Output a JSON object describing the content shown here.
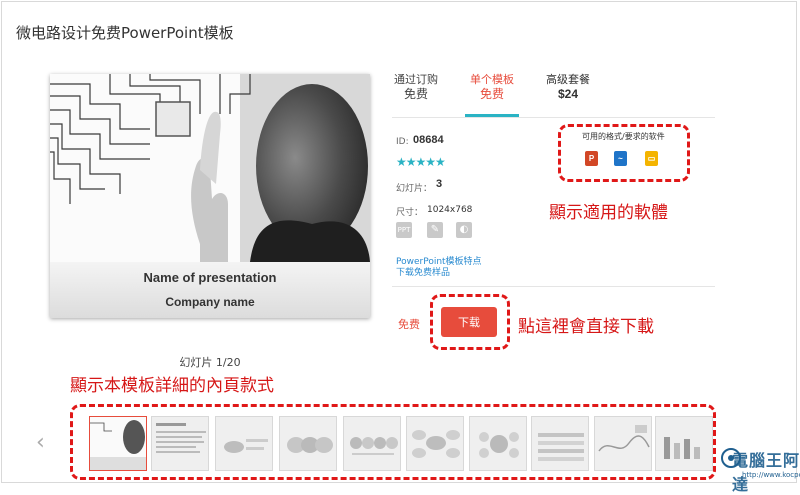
{
  "page_title": "微电路设计免费PowerPoint模板",
  "preview": {
    "presentation_name": "Name of presentation",
    "company_name": "Company name"
  },
  "tabs": [
    {
      "label": "通过订购",
      "price": "免费"
    },
    {
      "label": "单个模板",
      "price": "免费"
    },
    {
      "label": "高级套餐",
      "price": "$24"
    }
  ],
  "details": {
    "id_label": "ID:",
    "id_value": "08684",
    "rating_stars": "★★★★★",
    "rating": 4.5,
    "slides_label": "幻灯片：",
    "slides_value": "3",
    "size_label": "尺寸：",
    "size_value": "1024x768"
  },
  "links": {
    "features": "PowerPoint模板特点",
    "download_sample": "下载免费样品"
  },
  "software": {
    "title": "可用的格式/要求的软件",
    "icons": [
      "powerpoint-icon",
      "keynote-icon",
      "google-slides-icon"
    ]
  },
  "purchase": {
    "price": "免费",
    "download_button": "下载"
  },
  "slide_counter": "幻灯片 1/20",
  "annotations": {
    "software": "顯示適用的軟體",
    "download": "點這裡會直接下載",
    "thumbnails": "顯示本模板詳細的內頁款式"
  },
  "watermark": {
    "text": "電腦王阿達",
    "url": "http://www.kocpc.com.tw"
  },
  "colors": {
    "accent_red": "#e74c3c",
    "annotation_red": "#d61717",
    "tab_underline": "#2ab3c4",
    "link_blue": "#2a8bd0"
  }
}
